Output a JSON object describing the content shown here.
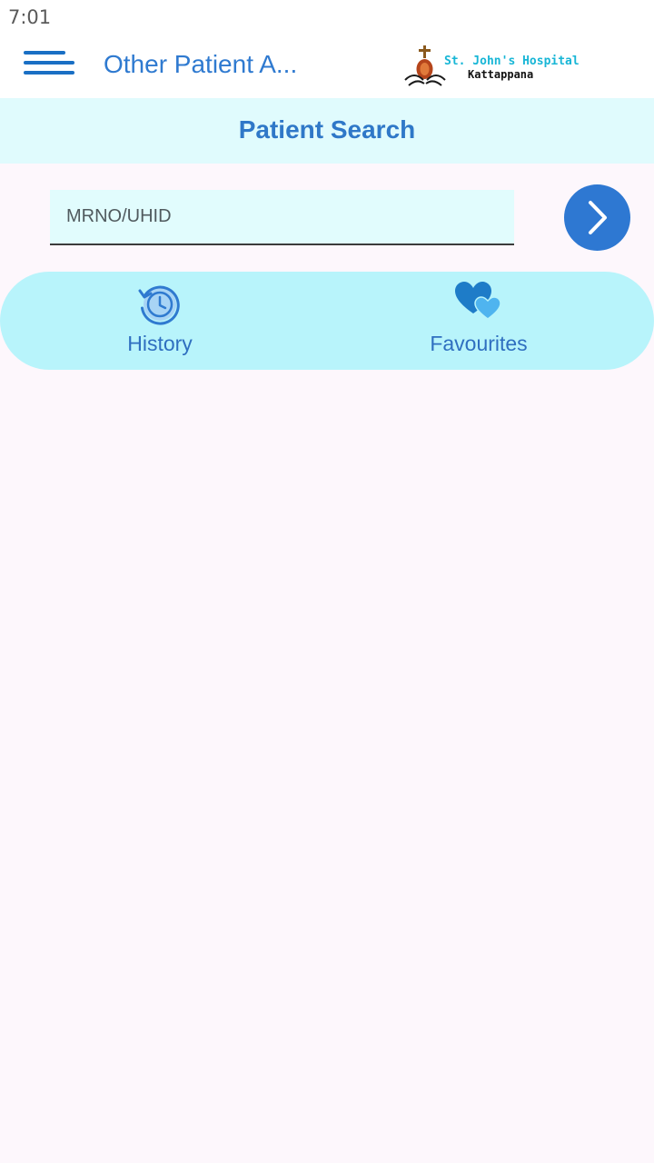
{
  "status_bar": {
    "time": "7:01"
  },
  "app_bar": {
    "title": "Other Patient A...",
    "logo": {
      "name": "St. John's Hospital",
      "place": "Kattappana"
    }
  },
  "search": {
    "header": "Patient Search",
    "placeholder": "MRNO/UHID",
    "value": ""
  },
  "tabs": [
    {
      "label": "History",
      "icon": "history-clock-icon"
    },
    {
      "label": "Favourites",
      "icon": "hearts-icon"
    }
  ],
  "colors": {
    "primary": "#2e78d2",
    "header_bg": "#e0fbfd",
    "tab_bg": "#b8f4fb",
    "page_bg": "#fdf7fc"
  }
}
